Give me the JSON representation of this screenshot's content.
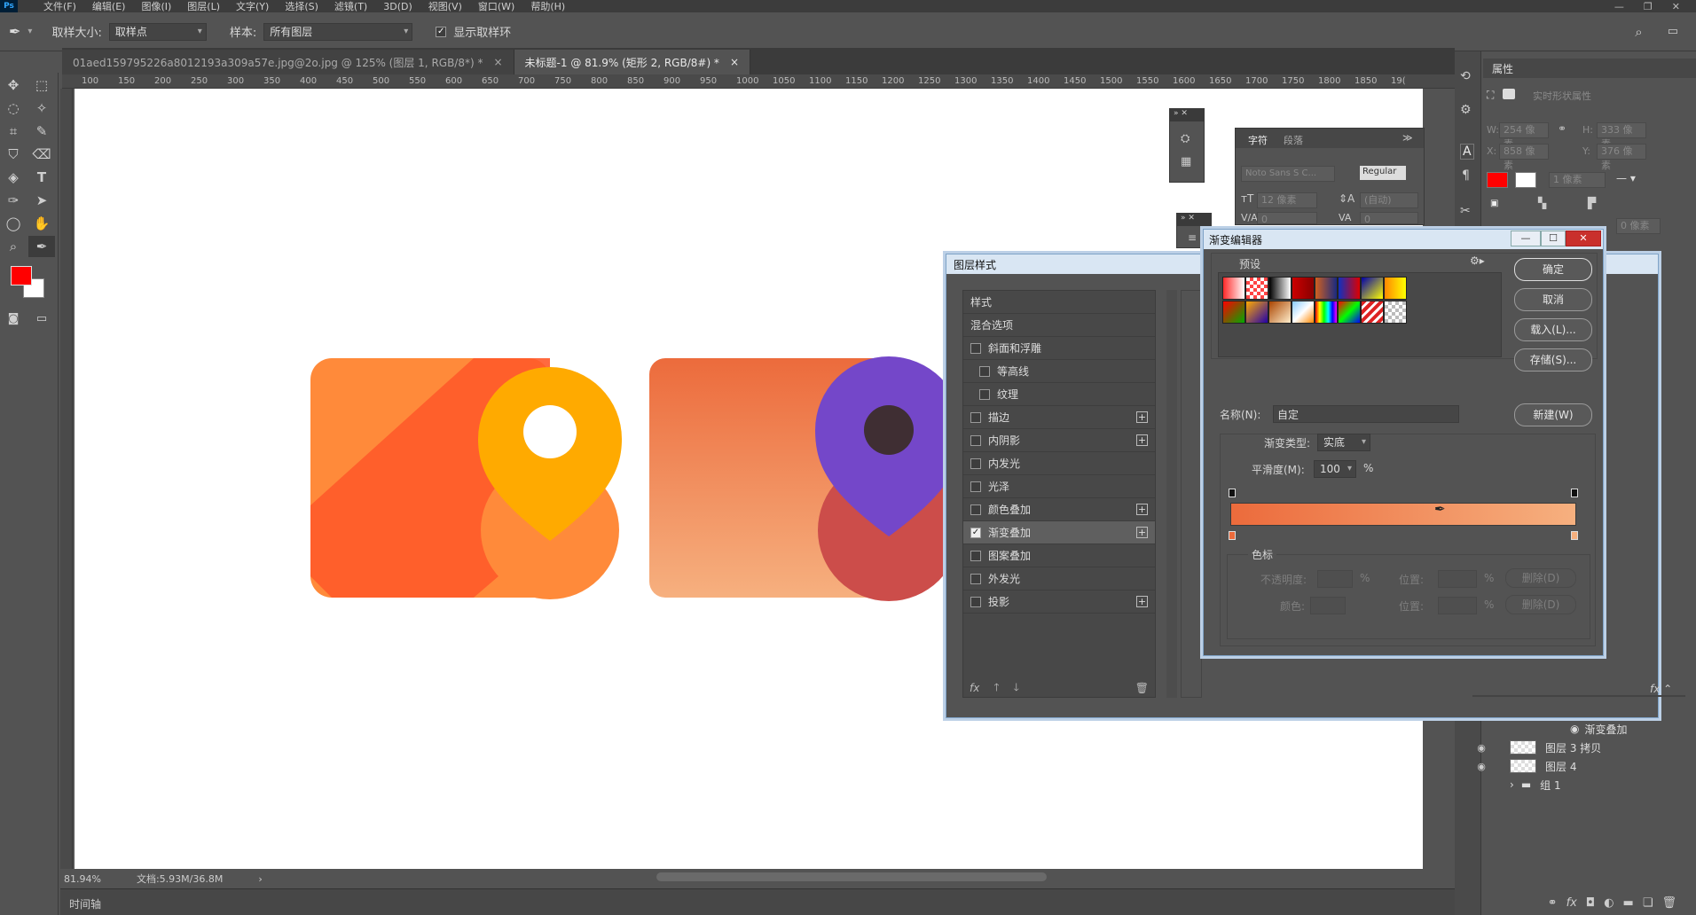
{
  "app": {
    "logo": "Ps"
  },
  "menu": [
    "文件(F)",
    "编辑(E)",
    "图像(I)",
    "图层(L)",
    "文字(Y)",
    "选择(S)",
    "滤镜(T)",
    "3D(D)",
    "视图(V)",
    "窗口(W)",
    "帮助(H)"
  ],
  "options": {
    "sample_size_label": "取样大小:",
    "sample_size_value": "取样点",
    "sample_label": "样本:",
    "sample_value": "所有图层",
    "show_ring_label": "显示取样环"
  },
  "tabs": [
    {
      "label": "01aed159795226a8012193a309a57e.jpg@2o.jpg @ 125% (图层 1, RGB/8*) *",
      "close": "×"
    },
    {
      "label": "未标题-1 @ 81.9% (矩形 2, RGB/8#) *",
      "close": "×"
    }
  ],
  "ruler_ticks": [
    "100",
    "150",
    "200",
    "250",
    "300",
    "350",
    "400",
    "450",
    "500",
    "550",
    "600",
    "650",
    "700",
    "750",
    "800",
    "850",
    "900",
    "950",
    "1000",
    "1050",
    "1100",
    "1150",
    "1200",
    "1250",
    "1300",
    "1350",
    "1400",
    "1450",
    "1500",
    "1550",
    "1600",
    "1650",
    "1700",
    "1750",
    "1800",
    "1850",
    "19("
  ],
  "status": {
    "zoom": "81.94%",
    "doc": "文档:5.93M/36.8M",
    "arrow": "›"
  },
  "timeline": "时间轴",
  "properties": {
    "title": "属性",
    "subtitle": "实时形状属性",
    "w_label": "W:",
    "w_value": "254 像素",
    "h_label": "H:",
    "h_value": "333 像素",
    "x_label": "X:",
    "x_value": "858 像素",
    "y_label": "Y:",
    "y_value": "376 像素",
    "stroke_value": "1 像素",
    "extra_value": "0 像素"
  },
  "char_panel": {
    "tab_char": "字符",
    "tab_para": "段落",
    "font_family": "Noto Sans S C...",
    "font_style": "Regular",
    "font_size": "12 像素",
    "leading": "(自动)",
    "tracking_a": "0",
    "tracking_b": "0"
  },
  "layer_style": {
    "title": "图层样式",
    "items": [
      {
        "label": "样式",
        "check": false,
        "hascheck": false,
        "plus": false,
        "indent": false
      },
      {
        "label": "混合选项",
        "check": false,
        "hascheck": false,
        "plus": false,
        "indent": false
      },
      {
        "label": "斜面和浮雕",
        "check": false,
        "hascheck": true,
        "plus": false,
        "indent": false
      },
      {
        "label": "等高线",
        "check": false,
        "hascheck": true,
        "plus": false,
        "indent": true
      },
      {
        "label": "纹理",
        "check": false,
        "hascheck": true,
        "plus": false,
        "indent": true
      },
      {
        "label": "描边",
        "check": false,
        "hascheck": true,
        "plus": true,
        "indent": false
      },
      {
        "label": "内阴影",
        "check": false,
        "hascheck": true,
        "plus": true,
        "indent": false
      },
      {
        "label": "内发光",
        "check": false,
        "hascheck": true,
        "plus": false,
        "indent": false
      },
      {
        "label": "光泽",
        "check": false,
        "hascheck": true,
        "plus": false,
        "indent": false
      },
      {
        "label": "颜色叠加",
        "check": false,
        "hascheck": true,
        "plus": true,
        "indent": false
      },
      {
        "label": "渐变叠加",
        "check": true,
        "hascheck": true,
        "plus": true,
        "indent": false
      },
      {
        "label": "图案叠加",
        "check": false,
        "hascheck": true,
        "plus": false,
        "indent": false
      },
      {
        "label": "外发光",
        "check": false,
        "hascheck": true,
        "plus": false,
        "indent": false
      },
      {
        "label": "投影",
        "check": false,
        "hascheck": true,
        "plus": true,
        "indent": false
      }
    ],
    "fx": "fx"
  },
  "gradient_editor": {
    "title": "渐变编辑器",
    "presets_label": "预设",
    "ok": "确定",
    "cancel": "取消",
    "load": "载入(L)...",
    "save": "存储(S)...",
    "name_label": "名称(N):",
    "name_value": "自定",
    "new": "新建(W)",
    "type_label": "渐变类型:",
    "type_value": "实底",
    "smooth_label": "平滑度(M):",
    "smooth_value": "100",
    "percent": "%",
    "stops_label": "色标",
    "opacity_label": "不透明度:",
    "position_label": "位置:",
    "delete_label": "删除(D)",
    "color_label": "颜色:",
    "color_start": "#ec6b3c",
    "color_end": "#f6b07f"
  },
  "behind_dialog": {
    "ellipsis": ")..."
  },
  "layers": [
    {
      "label": "渐变叠加",
      "type": "effect"
    },
    {
      "label": "图层 3 拷贝",
      "type": "layer"
    },
    {
      "label": "图层 4",
      "type": "layer"
    },
    {
      "label": "组 1",
      "type": "group"
    }
  ]
}
